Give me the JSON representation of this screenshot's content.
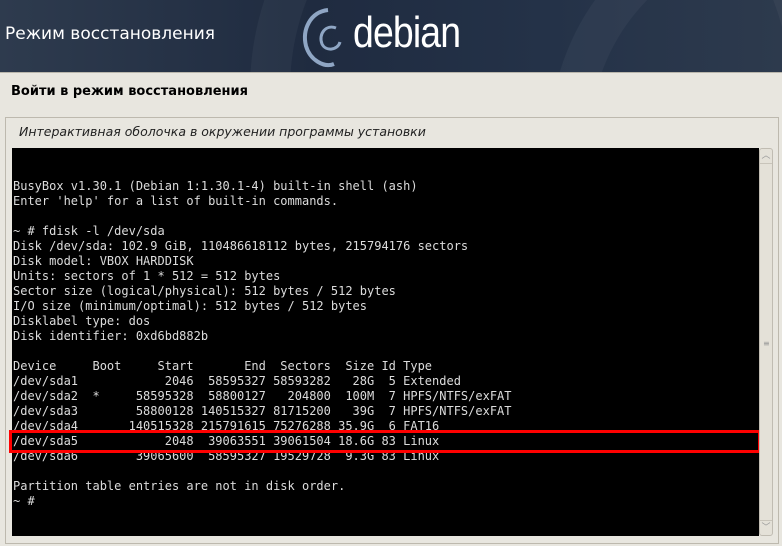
{
  "header": {
    "title": "Режим восстановления",
    "logo_text": "debian"
  },
  "step_title": "Войти в режим восстановления",
  "panel_title": "Интерактивная оболочка в окружении программы установки",
  "terminal": {
    "lines": [
      "BusyBox v1.30.1 (Debian 1:1.30.1-4) built-in shell (ash)",
      "Enter 'help' for a list of built-in commands.",
      "",
      "~ # fdisk -l /dev/sda",
      "Disk /dev/sda: 102.9 GiB, 110486618112 bytes, 215794176 sectors",
      "Disk model: VBOX HARDDISK",
      "Units: sectors of 1 * 512 = 512 bytes",
      "Sector size (logical/physical): 512 bytes / 512 bytes",
      "I/O size (minimum/optimal): 512 bytes / 512 bytes",
      "Disklabel type: dos",
      "Disk identifier: 0xd6bd882b",
      "",
      "Device     Boot     Start       End  Sectors  Size Id Type",
      "/dev/sda1            2046  58595327 58593282   28G  5 Extended",
      "/dev/sda2  *     58595328  58800127   204800  100M  7 HPFS/NTFS/exFAT",
      "/dev/sda3        58800128 140515327 81715200   39G  7 HPFS/NTFS/exFAT",
      "/dev/sda4       140515328 215791615 75276288 35.9G  6 FAT16",
      "/dev/sda5            2048  39063551 39061504 18.6G 83 Linux",
      "/dev/sda6        39065600  58595327 19529728  9.3G 83 Linux",
      "",
      "Partition table entries are not in disk order.",
      "~ # "
    ],
    "highlighted_partition": "/dev/sda5"
  },
  "colors": {
    "highlight": "#ff0000",
    "terminal_bg": "#000000"
  }
}
